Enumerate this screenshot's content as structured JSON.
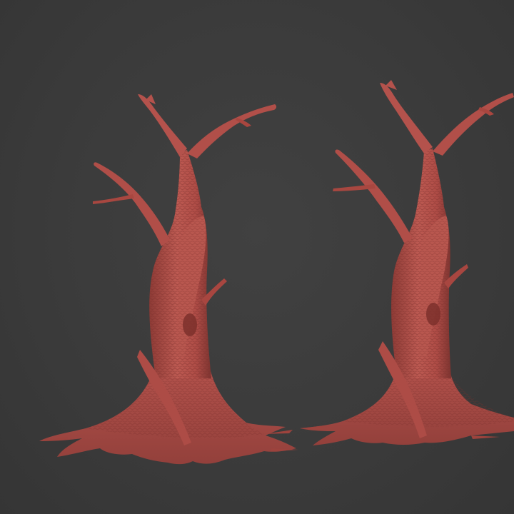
{
  "viewport": {
    "background": "#3a3a3a"
  },
  "objects": [
    {
      "kind": "tree-sculpt",
      "icon": "dead-tree-icon",
      "color": "#b8504a"
    },
    {
      "kind": "tree-sculpt",
      "icon": "dead-tree-icon",
      "color": "#b8504a"
    }
  ]
}
